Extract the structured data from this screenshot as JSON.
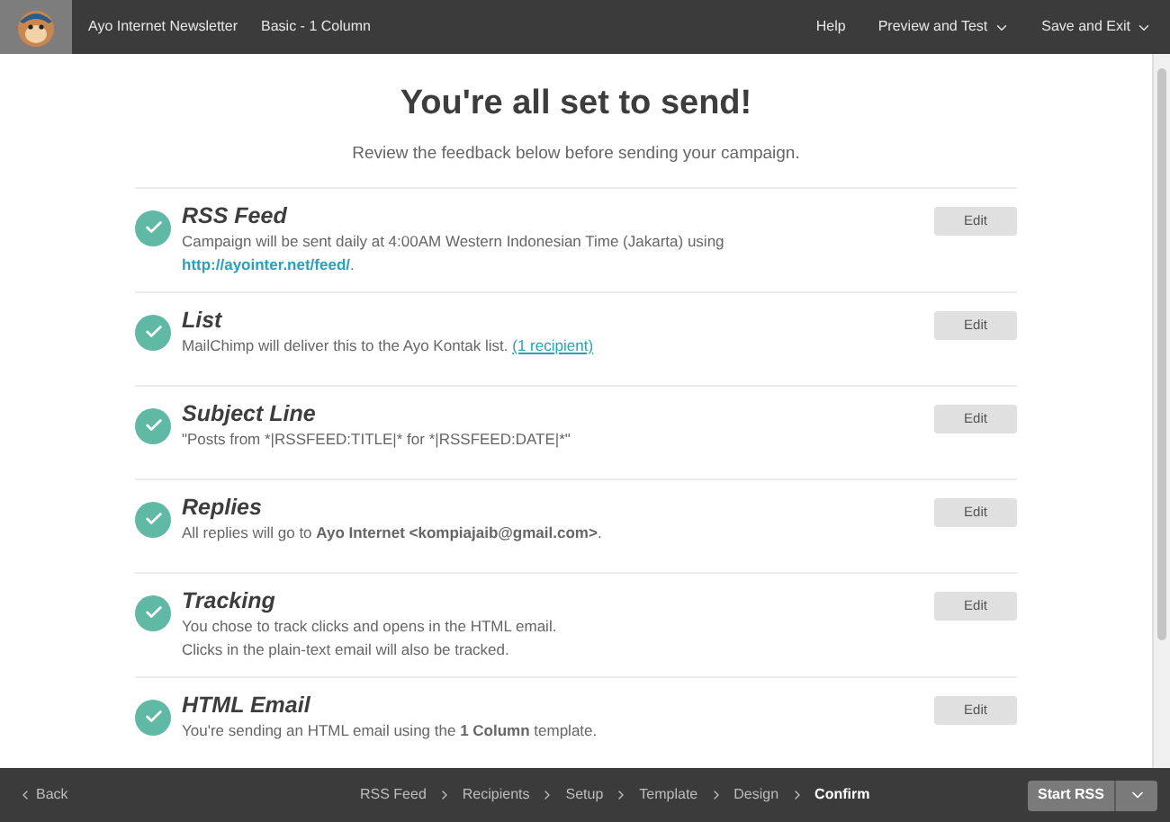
{
  "topbar": {
    "campaign": "Ayo Internet Newsletter",
    "template": "Basic - 1 Column",
    "menu": [
      {
        "label": "Help",
        "dropdown": false
      },
      {
        "label": "Preview and Test",
        "dropdown": true
      },
      {
        "label": "Save and Exit",
        "dropdown": true
      }
    ]
  },
  "heading": "You're all set to send!",
  "subheading": "Review the feedback below before sending your campaign.",
  "sections": [
    {
      "title": "RSS Feed",
      "checked": true,
      "lines": [
        {
          "text": "Campaign will be sent daily at 4:00AM Western Indonesian Time (Jakarta) using"
        },
        {
          "link": {
            "text": "http://ayointer.net/feed/",
            "kind": "url"
          },
          "after": "."
        }
      ],
      "button": "Edit"
    },
    {
      "title": "List",
      "checked": true,
      "lines": [
        {
          "text": "MailChimp will deliver this to the Ayo Kontak list.",
          "link": {
            "text": "(1 recipient)",
            "kind": "underlined"
          }
        }
      ],
      "button": "Edit"
    },
    {
      "title": "Subject Line",
      "checked": true,
      "lines": [
        {
          "text": "\"Posts from *|RSSFEED:TITLE|* for *|RSSFEED:DATE|*\""
        }
      ],
      "button": "Edit"
    },
    {
      "title": "Replies",
      "checked": true,
      "lines": [
        {
          "html": "All replies will go to **Ayo Internet <kompiajaib@gmail.com>**."
        }
      ],
      "button": "Edit"
    },
    {
      "title": "Tracking",
      "checked": true,
      "lines": [
        {
          "text": "You chose to track clicks and opens in the HTML email."
        },
        {
          "text": "Clicks in the plain-text email will also be tracked."
        }
      ],
      "button": "Edit"
    },
    {
      "title": "HTML Email",
      "checked": true,
      "lines": [
        {
          "html": "You're sending an HTML email using the **1 Column** template."
        }
      ],
      "button": "Edit"
    }
  ],
  "footer": {
    "back": "Back",
    "steps": [
      {
        "label": "RSS Feed",
        "selected": false
      },
      {
        "label": "Recipients",
        "selected": false
      },
      {
        "label": "Setup",
        "selected": false
      },
      {
        "label": "Template",
        "selected": false
      },
      {
        "label": "Design",
        "selected": false
      },
      {
        "label": "Confirm",
        "selected": true
      }
    ],
    "primary": "Start RSS"
  }
}
